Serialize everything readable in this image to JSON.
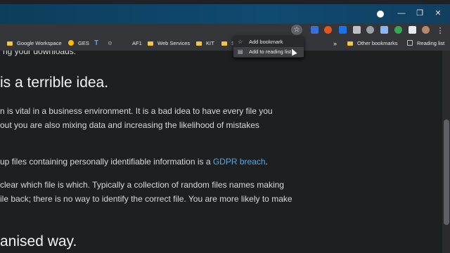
{
  "bookmarks": [
    {
      "label": "Google Workspace",
      "kind": "folder"
    },
    {
      "label": "GES",
      "kind": "site"
    },
    {
      "label": "AF1",
      "kind": "site"
    },
    {
      "label": "Web Services",
      "kind": "folder"
    },
    {
      "label": "KIT",
      "kind": "folder"
    },
    {
      "label": "S",
      "kind": "folder"
    }
  ],
  "other_bookmarks": "Other bookmarks",
  "reading_list": "Reading list",
  "overflow_chevron": "»",
  "menu": {
    "items": [
      "Add bookmark",
      "Add to reading list"
    ]
  },
  "content": {
    "top_fragment": "ng your downloads.",
    "heading1": "is a terrible idea.",
    "para1_line1": "n is vital in a business environment. It is a bad idea to have every file you",
    "para1_line2": "out you are also mixing data and increasing the likelihood of mistakes",
    "para2_text": "up files containing personally identifiable information is a ",
    "para2_link": "GDPR breach",
    "para2_end": ".",
    "para3_line1": " clear which file is which. Typically a collection of random files names making",
    "para3_line2": "ile back; there is no way to identify the correct file. You are more likely to make",
    "heading2": "anised way."
  },
  "colors": {
    "accent_link": "#5aa5e0",
    "page_bg": "#1e1f20",
    "toolbar_bg": "#35363a"
  }
}
